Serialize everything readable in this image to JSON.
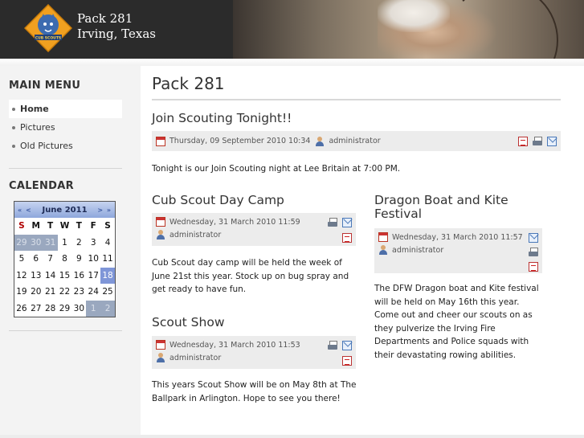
{
  "site": {
    "name_line1": "Pack 281",
    "name_line2": "Irving, Texas",
    "logo_text": "CUB SCOUTS"
  },
  "sidebar": {
    "menu_heading": "MAIN MENU",
    "menu_items": [
      {
        "label": "Home",
        "active": true
      },
      {
        "label": "Pictures",
        "active": false
      },
      {
        "label": "Old Pictures",
        "active": false
      }
    ],
    "calendar_heading": "CALENDAR",
    "calendar": {
      "month_label": "June 2011",
      "prev_nav": "« <",
      "next_nav": "> »",
      "weekdays": [
        "S",
        "M",
        "T",
        "W",
        "T",
        "F",
        "S"
      ],
      "weeks": [
        [
          {
            "d": "29",
            "t": "other"
          },
          {
            "d": "30",
            "t": "other"
          },
          {
            "d": "31",
            "t": "other"
          },
          {
            "d": "1"
          },
          {
            "d": "2"
          },
          {
            "d": "3"
          },
          {
            "d": "4"
          }
        ],
        [
          {
            "d": "5"
          },
          {
            "d": "6"
          },
          {
            "d": "7"
          },
          {
            "d": "8"
          },
          {
            "d": "9"
          },
          {
            "d": "10"
          },
          {
            "d": "11"
          }
        ],
        [
          {
            "d": "12"
          },
          {
            "d": "13"
          },
          {
            "d": "14"
          },
          {
            "d": "15"
          },
          {
            "d": "16"
          },
          {
            "d": "17"
          },
          {
            "d": "18",
            "t": "today"
          }
        ],
        [
          {
            "d": "19"
          },
          {
            "d": "20"
          },
          {
            "d": "21"
          },
          {
            "d": "22"
          },
          {
            "d": "23"
          },
          {
            "d": "24"
          },
          {
            "d": "25"
          }
        ],
        [
          {
            "d": "26"
          },
          {
            "d": "27"
          },
          {
            "d": "28"
          },
          {
            "d": "29"
          },
          {
            "d": "30"
          },
          {
            "d": "1",
            "t": "other"
          },
          {
            "d": "2",
            "t": "other"
          }
        ]
      ]
    }
  },
  "main": {
    "page_title": "Pack 281",
    "articles": {
      "join": {
        "title": "Join Scouting Tonight!!",
        "date": "Thursday, 09 September 2010 10:34",
        "author": "administrator",
        "body": "Tonight is our Join Scouting night at Lee Britain at 7:00 PM."
      },
      "daycamp": {
        "title": "Cub Scout Day Camp",
        "date": "Wednesday, 31 March 2010 11:59",
        "author": "administrator",
        "body": "Cub Scout day camp will be held the week of June 21st this year.  Stock up on bug spray and get ready to have fun."
      },
      "dragon": {
        "title_line1": "Dragon Boat and Kite",
        "title_line2": "Festival",
        "date": "Wednesday, 31 March 2010 11:57",
        "author": "administrator",
        "body": "The DFW Dragon boat and Kite festival will be held on May 16th this year.  Come out and cheer our scouts on as they pulverize the Irving Fire Departments and Police squads with their devastating rowing abilities."
      },
      "show": {
        "title": "Scout Show",
        "date": "Wednesday, 31 March 2010 11:53",
        "author": "administrator",
        "body": "This years Scout Show will be on May 8th at The Ballpark in Arlington.  Hope to see you there!"
      }
    }
  }
}
